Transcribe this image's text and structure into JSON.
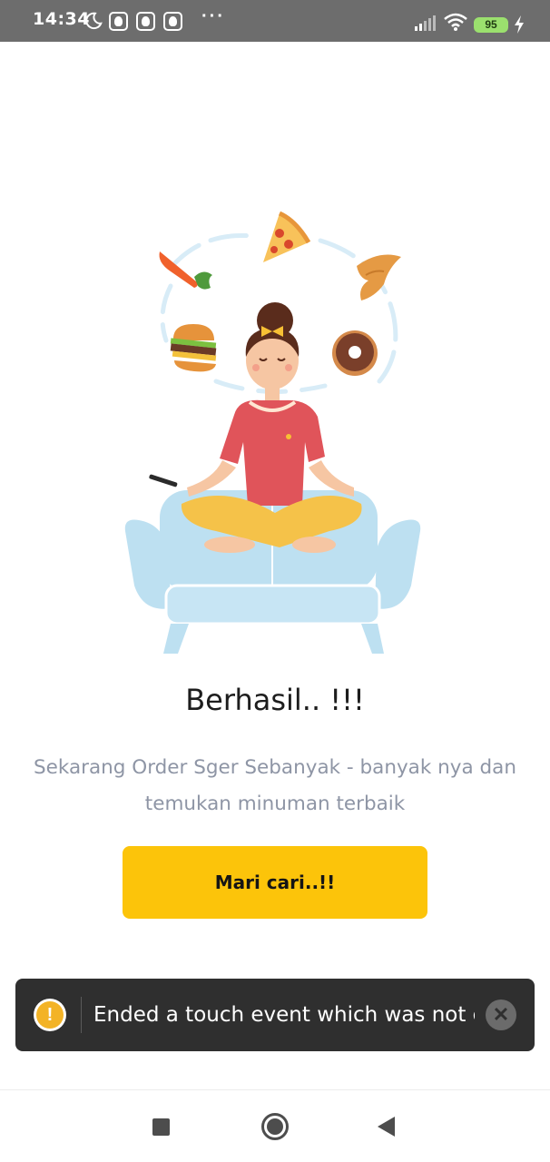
{
  "status_bar": {
    "time": "14:34",
    "more_indicator": "···",
    "battery_level": "95",
    "icons": [
      "moon-icon",
      "notification-icon",
      "notification-icon",
      "notification-icon",
      "signal-icon",
      "wifi-icon",
      "battery-icon",
      "charging-bolt-icon"
    ]
  },
  "illustration": {
    "icons": [
      "carrot-icon",
      "pizza-icon",
      "croissant-icon",
      "burger-icon",
      "donut-icon",
      "woman-meditating-on-sofa"
    ]
  },
  "main": {
    "title": "Berhasil.. !!!",
    "subtitle": "Sekarang Order Sger Sebanyak - banyak nya dan temukan minuman terbaik",
    "button_label": "Mari cari..!!"
  },
  "toast": {
    "icon": "warning-icon",
    "message": "Ended a touch event which was not co...",
    "close_icon": "close-icon"
  },
  "nav_bar": {
    "icons": [
      "recents-icon",
      "home-icon",
      "back-icon"
    ]
  },
  "colors": {
    "accent": "#fcc40a",
    "status_bar": "#6d6d6d",
    "toast_bg": "#2f2f2f",
    "subtitle_text": "#8e95a5"
  }
}
